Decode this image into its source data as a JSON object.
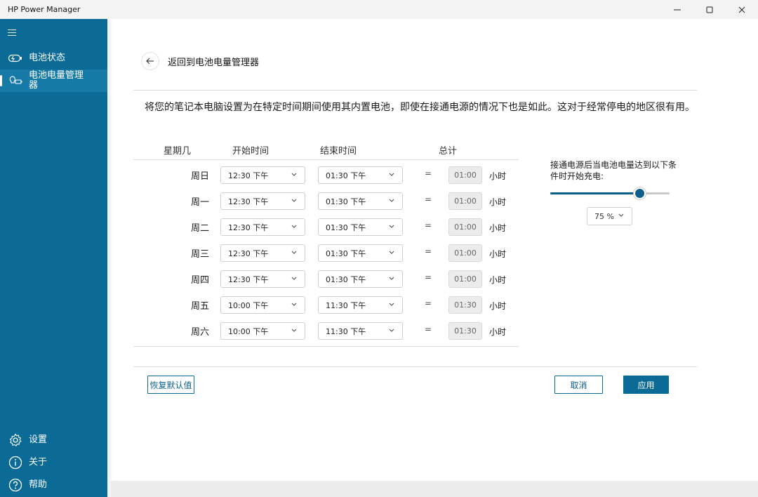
{
  "window": {
    "title": "HP Power Manager"
  },
  "sidebar": {
    "items": [
      {
        "label": "电池状态",
        "icon": "battery-status-icon"
      },
      {
        "label": "电池电量管理器",
        "icon": "battery-manager-icon"
      }
    ],
    "bottom_items": [
      {
        "label": "设置",
        "icon": "gear-icon"
      },
      {
        "label": "关于",
        "icon": "info-icon"
      },
      {
        "label": "帮助",
        "icon": "help-icon"
      }
    ]
  },
  "header": {
    "back_title": "返回到电池电量管理器"
  },
  "description": "将您的笔记本电脑设置为在特定时间期间使用其内置电池，即使在接通电源的情况下也是如此。这对于经常停电的地区很有用。",
  "schedule": {
    "columns": [
      "星期几",
      "开始时间",
      "结束时间",
      "总计"
    ],
    "equals": "=",
    "unit": "小时",
    "rows": [
      {
        "day": "周日",
        "start": "12:30 下午",
        "end": "01:30 下午",
        "total": "01:00"
      },
      {
        "day": "周一",
        "start": "12:30 下午",
        "end": "01:30 下午",
        "total": "01:00"
      },
      {
        "day": "周二",
        "start": "12:30 下午",
        "end": "01:30 下午",
        "total": "01:00"
      },
      {
        "day": "周三",
        "start": "12:30 下午",
        "end": "01:30 下午",
        "total": "01:00"
      },
      {
        "day": "周四",
        "start": "12:30 下午",
        "end": "01:30 下午",
        "total": "01:00"
      },
      {
        "day": "周五",
        "start": "10:00 下午",
        "end": "11:30 下午",
        "total": "01:30"
      },
      {
        "day": "周六",
        "start": "10:00 下午",
        "end": "11:30 下午",
        "total": "01:30"
      }
    ]
  },
  "charge": {
    "label": "接通电源后当电池电量达到以下条件时开始充电:",
    "level_percent": 75,
    "selected": "75 %"
  },
  "buttons": {
    "restore": "恢复默认值",
    "cancel": "取消",
    "apply": "应用"
  },
  "colors": {
    "accent": "#0b6a96",
    "sidebar": "#0b6a96"
  }
}
